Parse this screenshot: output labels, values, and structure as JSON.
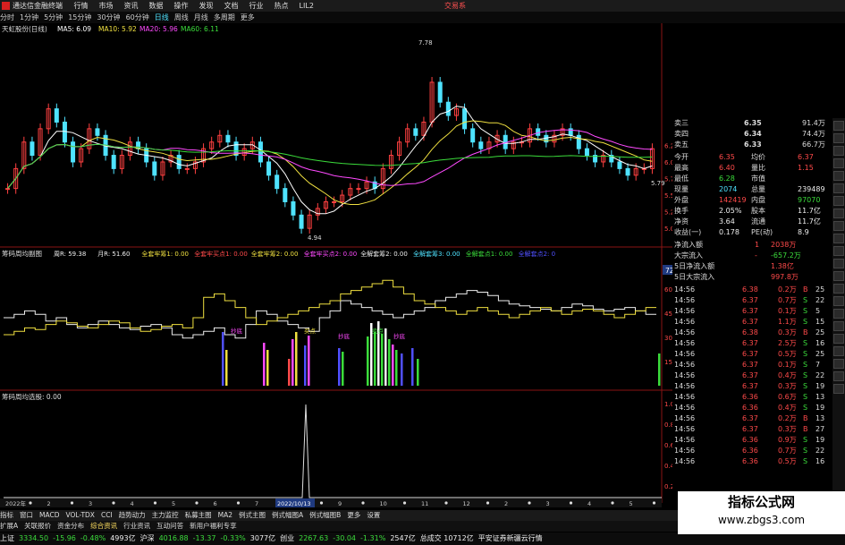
{
  "titlebar": {
    "app_name": "通达信金融终端",
    "menus": [
      "行情",
      "市场",
      "资讯",
      "数据",
      "操作",
      "发现",
      "文档",
      "行业",
      "热点",
      "LIL2"
    ],
    "right_text": "交易系"
  },
  "periodbar": {
    "periods": [
      "分时",
      "1分钟",
      "5分钟",
      "15分钟",
      "30分钟",
      "60分钟",
      "日线",
      "周线",
      "月线",
      "多周期",
      "更多"
    ],
    "active": "日线"
  },
  "main_panel": {
    "stock_name": "天虹股份(日线)",
    "ma": [
      {
        "label": "MA5: 6.09",
        "color": "#ffffff"
      },
      {
        "label": "MA10: 5.92",
        "color": "#f0e040"
      },
      {
        "label": "MA20: 5.96",
        "color": "#ff4aff"
      },
      {
        "label": "MA60: 6.11",
        "color": "#3bdc3b"
      }
    ],
    "high_label": "7.78",
    "low_label": "4.94",
    "last_label": "5.79",
    "y_ticks": [
      "6.25",
      "6.00",
      "5.75",
      "5.50",
      "5.25",
      "5.00"
    ],
    "price_range": [
      4.8,
      7.9
    ],
    "candles": [
      5.6,
      5.9,
      6.3,
      6.1,
      6.5,
      6.8,
      6.6,
      6.3,
      6.0,
      6.2,
      6.5,
      6.4,
      6.1,
      5.9,
      6.1,
      6.3,
      6.2,
      6.0,
      5.8,
      6.0,
      6.1,
      5.9,
      5.9,
      6.0,
      6.2,
      6.3,
      6.4,
      6.3,
      6.1,
      6.2,
      6.3,
      6.0,
      5.8,
      5.6,
      5.4,
      5.2,
      5.0,
      5.2,
      5.3,
      5.4,
      5.4,
      5.5,
      5.6,
      5.6,
      5.7,
      5.6,
      5.9,
      6.1,
      6.3,
      6.5,
      6.4,
      6.6,
      7.2,
      6.9,
      6.7,
      6.8,
      6.5,
      6.3,
      6.2,
      6.3,
      6.4,
      6.2,
      6.3,
      6.3,
      6.5,
      6.4,
      6.3,
      6.4,
      6.5,
      6.4,
      6.2,
      6.1,
      6.0,
      6.1,
      6.0,
      5.9,
      5.8,
      5.9,
      5.9,
      6.2
    ]
  },
  "panel2": {
    "title": "筹码周均副图",
    "params": [
      {
        "label": "周R: 59.38",
        "color": "#eeeeee"
      },
      {
        "label": "月R: 51.60",
        "color": "#eeeeee"
      },
      {
        "label": "全套牢筹1: 0.00",
        "color": "#f0e040"
      },
      {
        "label": "全套牢买点1: 0.00",
        "color": "#ff4a4a"
      },
      {
        "label": "全套牢筹2: 0.00",
        "color": "#f0e040"
      },
      {
        "label": "全套牢买点2: 0.00",
        "color": "#ff4aff"
      },
      {
        "label": "全解套筹2: 0.00",
        "color": "#eeeeee"
      },
      {
        "label": "全解套筹3: 0.00",
        "color": "#4fe3ff"
      },
      {
        "label": "全解套点1: 0.00",
        "color": "#3bdc3b"
      },
      {
        "label": "全解套点2: 0",
        "color": "#5050ff"
      }
    ],
    "current_value": "72.02",
    "y_ticks": [
      "60.00",
      "45.00",
      "30.00",
      "15.00"
    ],
    "signal_labels": [
      {
        "text": "抄底",
        "color": "#ff4aff"
      },
      {
        "text": "买点",
        "color": "#f0e040"
      },
      {
        "text": "抄底",
        "color": "#ff4aff"
      },
      {
        "text": "卖点",
        "color": "#3bdc3b"
      },
      {
        "text": "抄底",
        "color": "#ff4aff"
      }
    ]
  },
  "panel3": {
    "title": "筹码周均选股: 0.00",
    "y_ticks": [
      "1.00",
      "0.80",
      "0.60",
      "0.40",
      "0.20"
    ],
    "date_marker": "2022/10/13"
  },
  "xaxis": {
    "labels": [
      "2022年",
      "2",
      "3",
      "4",
      "5",
      "6",
      "7",
      "8",
      "9",
      "10",
      "11",
      "12",
      "2",
      "3",
      "4",
      "5"
    ]
  },
  "quote": {
    "asks": [
      {
        "label": "卖三",
        "price": "6.35",
        "vol": "91.4万"
      },
      {
        "label": "卖四",
        "price": "6.34",
        "vol": "74.4万"
      },
      {
        "label": "卖五",
        "price": "6.33",
        "vol": "66.7万"
      }
    ],
    "stats": [
      {
        "l1": "今开",
        "v1": "6.35",
        "c1": "red",
        "l2": "均价",
        "v2": "6.37",
        "c2": "red"
      },
      {
        "l1": "最高",
        "v1": "6.40",
        "c1": "red",
        "l2": "量比",
        "v2": "1.15",
        "c2": "red"
      },
      {
        "l1": "最低",
        "v1": "6.28",
        "c1": "green",
        "l2": "市值",
        "v2": "",
        "c2": "white"
      },
      {
        "l1": "现量",
        "v1": "2074",
        "c1": "cyan",
        "l2": "总量",
        "v2": "239489",
        "c2": "white"
      },
      {
        "l1": "外盘",
        "v1": "142419",
        "c1": "red",
        "l2": "内盘",
        "v2": "97070",
        "c2": "green"
      },
      {
        "l1": "换手",
        "v1": "2.05%",
        "c1": "white",
        "l2": "股本",
        "v2": "11.7亿",
        "c2": "white"
      },
      {
        "l1": "净资",
        "v1": "3.64",
        "c1": "white",
        "l2": "流通",
        "v2": "11.7亿",
        "c2": "white"
      },
      {
        "l1": "收益(一)",
        "v1": "0.178",
        "c1": "white",
        "l2": "PE(动)",
        "v2": "8.9",
        "c2": "white"
      }
    ],
    "flows": [
      {
        "label": "净流入额",
        "v1": "1",
        "v2": "2038万",
        "c2": "red"
      },
      {
        "label": "大宗流入",
        "v1": "-",
        "v2": "-657.2万",
        "c2": "green"
      },
      {
        "label": "5日净流入额",
        "v1": "",
        "v2": "1.38亿",
        "c2": "red"
      },
      {
        "label": "5日大宗流入",
        "v1": "",
        "v2": "997.8万",
        "c2": "red"
      }
    ],
    "trades": [
      {
        "t": "14:56",
        "p": "6.38",
        "v": "0.2万",
        "s": "B",
        "n": "25"
      },
      {
        "t": "14:56",
        "p": "6.37",
        "v": "0.7万",
        "s": "S",
        "n": "22"
      },
      {
        "t": "14:56",
        "p": "6.37",
        "v": "0.1万",
        "s": "S",
        "n": "5"
      },
      {
        "t": "14:56",
        "p": "6.37",
        "v": "1.1万",
        "s": "S",
        "n": "15"
      },
      {
        "t": "14:56",
        "p": "6.38",
        "v": "0.3万",
        "s": "B",
        "n": "25"
      },
      {
        "t": "14:56",
        "p": "6.37",
        "v": "2.5万",
        "s": "S",
        "n": "16"
      },
      {
        "t": "14:56",
        "p": "6.37",
        "v": "0.5万",
        "s": "S",
        "n": "25"
      },
      {
        "t": "14:56",
        "p": "6.37",
        "v": "0.1万",
        "s": "S",
        "n": "7"
      },
      {
        "t": "14:56",
        "p": "6.37",
        "v": "0.4万",
        "s": "S",
        "n": "22"
      },
      {
        "t": "14:56",
        "p": "6.37",
        "v": "0.3万",
        "s": "S",
        "n": "19"
      },
      {
        "t": "14:56",
        "p": "6.36",
        "v": "0.6万",
        "s": "S",
        "n": "13"
      },
      {
        "t": "14:56",
        "p": "6.36",
        "v": "0.4万",
        "s": "S",
        "n": "19"
      },
      {
        "t": "14:56",
        "p": "6.37",
        "v": "0.2万",
        "s": "B",
        "n": "13"
      },
      {
        "t": "14:56",
        "p": "6.37",
        "v": "0.3万",
        "s": "B",
        "n": "27"
      },
      {
        "t": "14:56",
        "p": "6.36",
        "v": "0.9万",
        "s": "S",
        "n": "19"
      },
      {
        "t": "14:56",
        "p": "6.36",
        "v": "0.7万",
        "s": "S",
        "n": "22"
      },
      {
        "t": "14:56",
        "p": "6.36",
        "v": "0.5万",
        "s": "S",
        "n": "16"
      }
    ]
  },
  "tabs": [
    "指标",
    "窗口",
    "MACD",
    "VOL-TDX",
    "CCI",
    "趋势动力",
    "主力监控",
    "私募主图",
    "MA2",
    "例式主图",
    "例式幅图A",
    "例式幅图B",
    "更多",
    "设置"
  ],
  "subtabs": [
    "扩展A",
    "关联报价",
    "资金分布",
    "综合资讯",
    "行业资讯",
    "互动问答",
    "新用户福利专享"
  ],
  "subtab_highlight": "综合资讯",
  "index_bar": {
    "items": [
      {
        "name": "上证",
        "val": "3334.50",
        "chg": "-15.96",
        "pct": "-0.48%",
        "amt": "4993亿"
      },
      {
        "name": "沪深",
        "val": "4016.88",
        "chg": "-13.37",
        "pct": "-0.33%",
        "amt": "3077亿"
      },
      {
        "name": "创业",
        "val": "2267.63",
        "chg": "-30.04",
        "pct": "-1.31%",
        "amt": "2547亿"
      }
    ],
    "total": "总成交 10712亿",
    "news": "平安证券新疆云行情"
  },
  "watermark": {
    "line1": "指标公式网",
    "line2": "www.zbgs3.com"
  }
}
